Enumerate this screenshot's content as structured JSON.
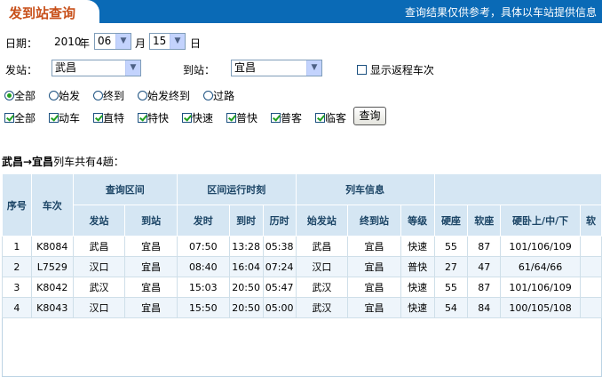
{
  "header": {
    "title": "发到站查询",
    "notice": "查询结果仅供参考，具体以车站提供信息"
  },
  "form": {
    "date_label": "日期：",
    "year": "2010",
    "year_unit": "年",
    "month": "06",
    "month_unit": "月",
    "day": "15",
    "day_unit": "日",
    "from_label": "发站：",
    "from_value": "武昌",
    "to_label": "到站：",
    "to_value": "宜昌",
    "return_label": "显示返程车次",
    "radio_options": [
      "全部",
      "始发",
      "终到",
      "始发终到",
      "过路"
    ],
    "checkbox_options": [
      "全部",
      "动车",
      "直特",
      "特快",
      "快速",
      "普快",
      "普客",
      "临客"
    ],
    "query_button": "查询"
  },
  "summary": {
    "route": "武昌→宜昌",
    "tail": "列车共有4趟："
  },
  "table": {
    "group_headers": [
      "查询区间",
      "区间运行时刻",
      "列车信息"
    ],
    "headers": {
      "seq": "序号",
      "train": "车次",
      "depart_station": "发站",
      "arrive_station": "到站",
      "depart_time": "发时",
      "arrive_time": "到时",
      "duration": "历时",
      "origin": "始发站",
      "terminal": "终到站",
      "grade": "等级",
      "hard_seat": "硬座",
      "soft_seat": "软座",
      "hard_sleeper": "硬卧上/中/下",
      "cut": "软"
    },
    "rows": [
      [
        "1",
        "K8084",
        "武昌",
        "宜昌",
        "07:50",
        "13:28",
        "05:38",
        "武昌",
        "宜昌",
        "快速",
        "55",
        "87",
        "101/106/109"
      ],
      [
        "2",
        "L7529",
        "汉口",
        "宜昌",
        "08:40",
        "16:04",
        "07:24",
        "汉口",
        "宜昌",
        "普快",
        "27",
        "47",
        "61/64/66"
      ],
      [
        "3",
        "K8042",
        "武汉",
        "宜昌",
        "15:03",
        "20:50",
        "05:47",
        "武汉",
        "宜昌",
        "快速",
        "55",
        "87",
        "101/106/109"
      ],
      [
        "4",
        "K8043",
        "汉口",
        "宜昌",
        "15:50",
        "20:50",
        "05:00",
        "武汉",
        "宜昌",
        "快速",
        "54",
        "84",
        "100/105/108"
      ]
    ]
  },
  "colors": {
    "header_bg": "#0a6ab6",
    "title": "#c8501a",
    "table_header_bg": "#d5e6f3",
    "alt_row_bg": "#eef5fb"
  }
}
